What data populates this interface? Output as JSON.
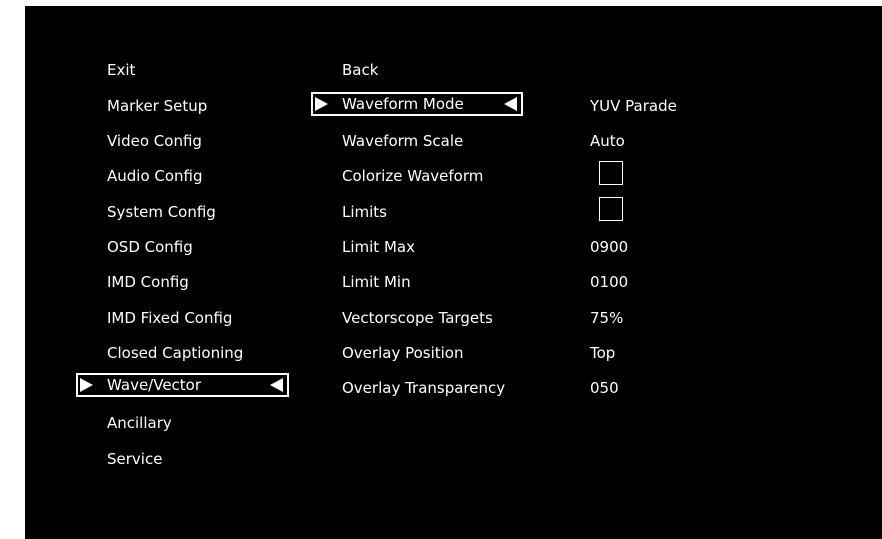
{
  "left_menu": {
    "items": [
      {
        "label": "Exit"
      },
      {
        "label": "Marker Setup"
      },
      {
        "label": "Video Config"
      },
      {
        "label": "Audio Config"
      },
      {
        "label": "System Config"
      },
      {
        "label": "OSD Config"
      },
      {
        "label": "IMD Config"
      },
      {
        "label": "IMD Fixed Config"
      },
      {
        "label": "Closed Captioning"
      },
      {
        "label": "Wave/Vector"
      },
      {
        "label": "Ancillary"
      },
      {
        "label": "Service"
      }
    ],
    "selected": "Wave/Vector"
  },
  "middle_menu": {
    "items": [
      {
        "label": "Back"
      },
      {
        "label": "Waveform Mode"
      },
      {
        "label": "Waveform Scale"
      },
      {
        "label": "Colorize Waveform"
      },
      {
        "label": "Limits"
      },
      {
        "label": "Limit Max"
      },
      {
        "label": "Limit Min"
      },
      {
        "label": "Vectorscope Targets"
      },
      {
        "label": "Overlay Position"
      },
      {
        "label": "Overlay Transparency"
      }
    ],
    "selected": "Waveform Mode"
  },
  "values": {
    "waveform_mode": "YUV Parade",
    "waveform_scale": "Auto",
    "colorize_waveform": false,
    "limits": false,
    "limit_max": "0900",
    "limit_min": "0100",
    "vectorscope_targets": "75%",
    "overlay_position": "Top",
    "overlay_transparency": "050"
  },
  "colors": {
    "background": "#000000",
    "text": "#ffffff"
  }
}
